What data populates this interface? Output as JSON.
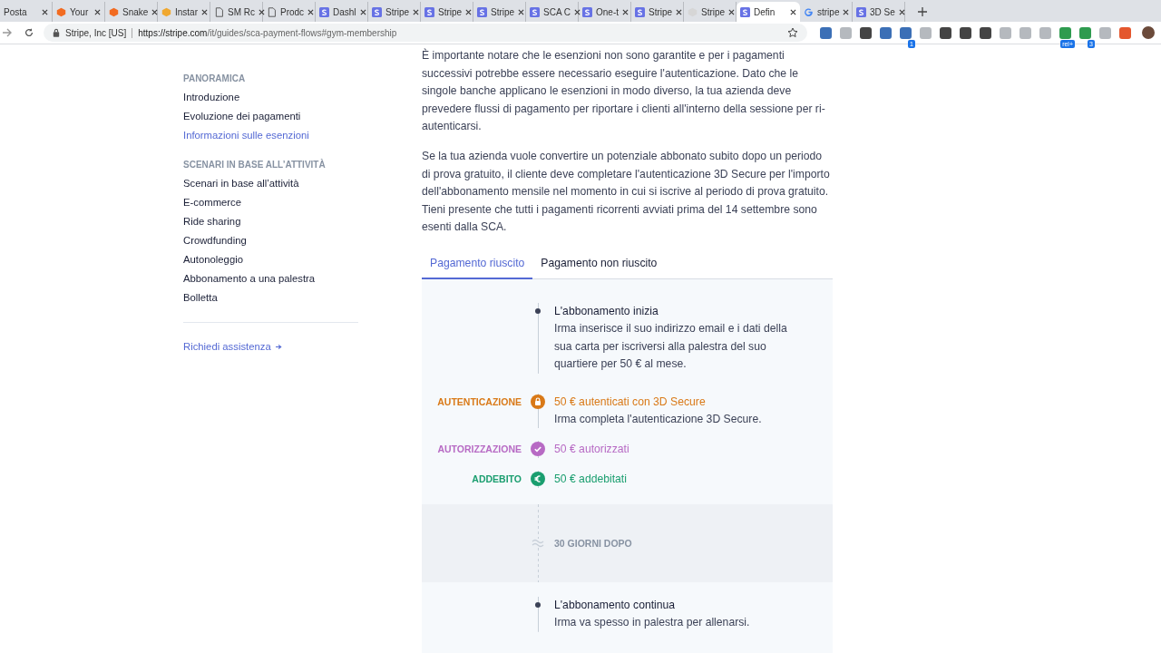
{
  "browser": {
    "tabs": [
      {
        "title": "Posta",
        "kind": "none",
        "selected": false
      },
      {
        "title": "Your",
        "kind": "cube",
        "selected": false
      },
      {
        "title": "Snake",
        "kind": "cube",
        "selected": false
      },
      {
        "title": "Instar",
        "kind": "box",
        "selected": false
      },
      {
        "title": "SM Rc",
        "kind": "doc",
        "selected": false
      },
      {
        "title": "Prodc",
        "kind": "doc",
        "selected": false
      },
      {
        "title": "Dashl",
        "kind": "s",
        "selected": false
      },
      {
        "title": "Stripe",
        "kind": "s",
        "selected": false
      },
      {
        "title": "Stripe",
        "kind": "s",
        "selected": false
      },
      {
        "title": "Stripe",
        "kind": "s",
        "selected": false
      },
      {
        "title": "SCA C",
        "kind": "s",
        "selected": false
      },
      {
        "title": "One-t",
        "kind": "s",
        "selected": false
      },
      {
        "title": "Stripe",
        "kind": "s",
        "selected": false
      },
      {
        "title": "Stripe",
        "kind": "grey",
        "selected": false
      },
      {
        "title": "Defin",
        "kind": "s",
        "selected": true
      },
      {
        "title": "stripe",
        "kind": "g",
        "selected": false
      },
      {
        "title": "3D Se",
        "kind": "s",
        "selected": false
      }
    ],
    "site_identity": "Stripe, Inc [US]",
    "url": {
      "host": "https://stripe.com",
      "path": "/it/guides/sca-payment-flows#gym-membership"
    },
    "extensions": [
      {
        "kind": "blue"
      },
      {
        "kind": "grey"
      },
      {
        "kind": "dark"
      },
      {
        "kind": "blue"
      },
      {
        "kind": "blue",
        "badge": "1"
      },
      {
        "kind": "grey"
      },
      {
        "kind": "dark"
      },
      {
        "kind": "dark"
      },
      {
        "kind": "dark"
      },
      {
        "kind": "grey"
      },
      {
        "kind": "grey"
      },
      {
        "kind": "grey"
      },
      {
        "kind": "green",
        "badge": "rel+"
      },
      {
        "kind": "green",
        "badge": "3"
      },
      {
        "kind": "grey"
      },
      {
        "kind": "red"
      }
    ]
  },
  "sidebar": {
    "sections": [
      {
        "heading": "PANORAMICA",
        "items": [
          {
            "label": "Introduzione",
            "selected": false
          },
          {
            "label": "Evoluzione dei pagamenti",
            "selected": false
          },
          {
            "label": "Informazioni sulle esenzioni",
            "selected": true
          }
        ]
      },
      {
        "heading": "SCENARI IN BASE ALL’ATTIVITÀ",
        "items": [
          {
            "label": "Scenari in base all’attività",
            "selected": false
          },
          {
            "label": "E-commerce",
            "selected": false
          },
          {
            "label": "Ride sharing",
            "selected": false
          },
          {
            "label": "Crowdfunding",
            "selected": false
          },
          {
            "label": "Autonoleggio",
            "selected": false
          },
          {
            "label": "Abbonamento a una palestra",
            "selected": false
          },
          {
            "label": "Bolletta",
            "selected": false
          }
        ]
      }
    ],
    "support_link": "Richiedi assistenza"
  },
  "article": {
    "paragraphs": [
      "È importante notare che le esenzioni non sono garantite e per i pagamenti successivi potrebbe essere necessario eseguire l'autenticazione. Dato che le singole banche applicano le esenzioni in modo diverso, la tua azienda deve prevedere flussi di pagamento per riportare i clienti all'interno della sessione per ri-autenticarsi.",
      "Se la tua azienda vuole convertire un potenziale abbonato subito dopo un periodo di prova gratuito, il cliente deve completare l'autenticazione 3D Secure per l'importo dell'abbonamento mensile nel momento in cui si iscrive al periodo di prova gratuito. Tieni presente che tutti i pagamenti ricorrenti avviati prima del 14 settembre sono esenti dalla SCA."
    ],
    "tabs": [
      {
        "label": "Pagamento riuscito",
        "selected": true
      },
      {
        "label": "Pagamento non riuscito",
        "selected": false
      }
    ],
    "timeline": [
      {
        "kind": "event",
        "title": "L'abbonamento inizia",
        "text": "Irma inserisce il suo indirizzo email e i dati della sua carta per iscriversi alla palestra del suo quartiere per 50 € al mese."
      },
      {
        "kind": "lock",
        "color": "#d97917",
        "label": "AUTENTICAZIONE",
        "title": "50 € autenticati con 3D Secure",
        "text": "Irma completa l'autenticazione 3D Secure."
      },
      {
        "kind": "check",
        "color": "#b76ac4",
        "label": "AUTORIZZAZIONE",
        "title": "50 € autorizzati"
      },
      {
        "kind": "euro",
        "color": "#1a9e6f",
        "label": "ADDEBITO",
        "title": "50 € addebitati"
      },
      {
        "kind": "gap",
        "title": "30 GIORNI DOPO"
      },
      {
        "kind": "event",
        "title": "L'abbonamento continua",
        "text": "Irma va spesso in palestra per allenarsi."
      }
    ]
  }
}
